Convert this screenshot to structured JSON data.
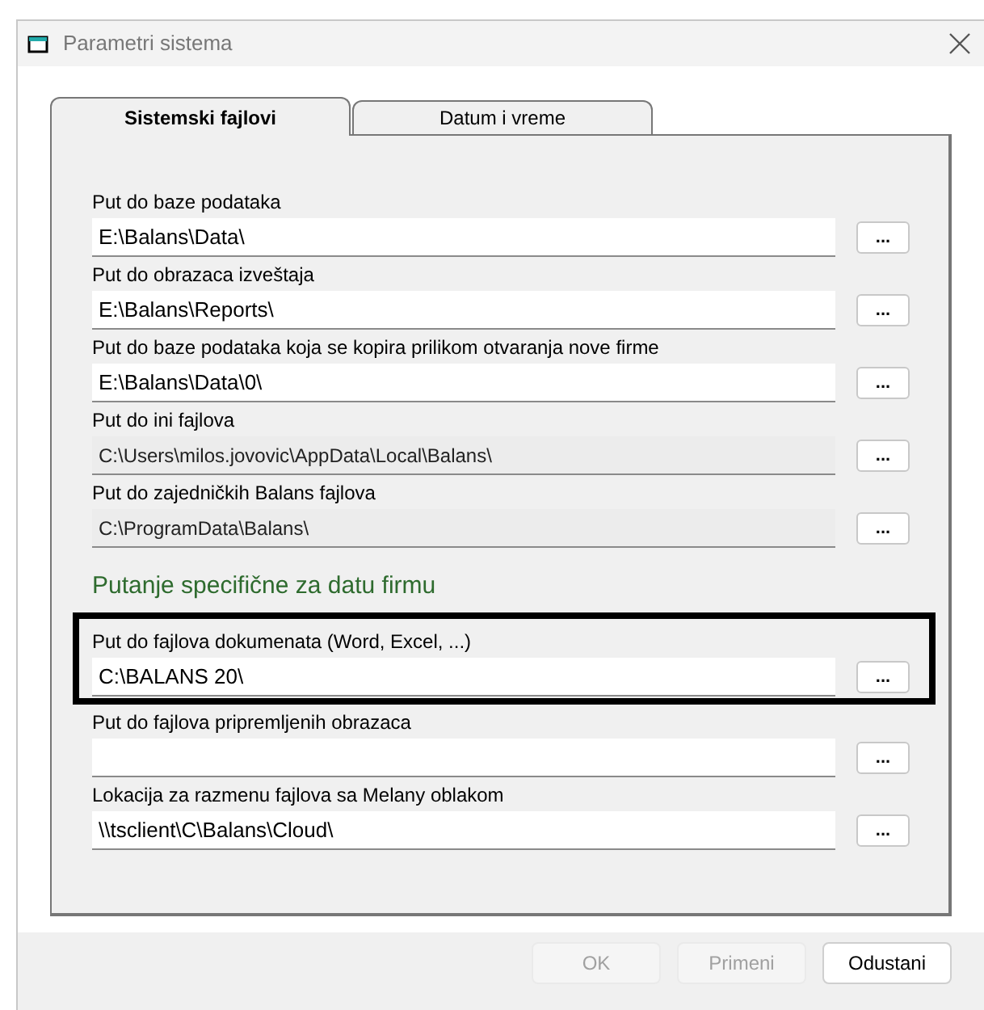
{
  "window": {
    "title": "Parametri sistema"
  },
  "tabs": [
    {
      "label": "Sistemski fajlovi",
      "selected": true
    },
    {
      "label": "Datum i vreme",
      "selected": false
    }
  ],
  "paths": [
    {
      "label": "Put do baze podataka",
      "value": "E:\\Balans\\Data\\",
      "disabled": false,
      "button": "..."
    },
    {
      "label": "Put do obrazaca izveštaja",
      "value": "E:\\Balans\\Reports\\",
      "disabled": false,
      "button": "..."
    },
    {
      "label": "Put do baze podataka koja se kopira prilikom otvaranja nove firme",
      "value": "E:\\Balans\\Data\\0\\",
      "disabled": false,
      "button": "..."
    },
    {
      "label": "Put do ini fajlova",
      "value": "C:\\Users\\milos.jovovic\\AppData\\Local\\Balans\\",
      "disabled": true,
      "button": "..."
    },
    {
      "label": "Put do zajedničkih Balans fajlova",
      "value": "C:\\ProgramData\\Balans\\",
      "disabled": true,
      "button": "..."
    }
  ],
  "section_heading": "Putanje specifične za datu firmu",
  "firm_paths": [
    {
      "label": "Put do fajlova dokumenata (Word, Excel, ...)",
      "value": "C:\\BALANS 20\\",
      "highlighted": true,
      "button": "..."
    },
    {
      "label": "Put do fajlova pripremljenih obrazaca",
      "highlighted": false,
      "button": "..."
    },
    {
      "label": "Lokacija za razmenu fajlova sa Melany oblakom",
      "value": "\\\\tsclient\\C\\Balans\\Cloud\\",
      "highlighted": false,
      "button": "..."
    }
  ],
  "buttons": [
    {
      "label": "OK",
      "disabled": true
    },
    {
      "label": "Primeni",
      "disabled": true
    },
    {
      "label": "Odustani",
      "disabled": false
    }
  ]
}
